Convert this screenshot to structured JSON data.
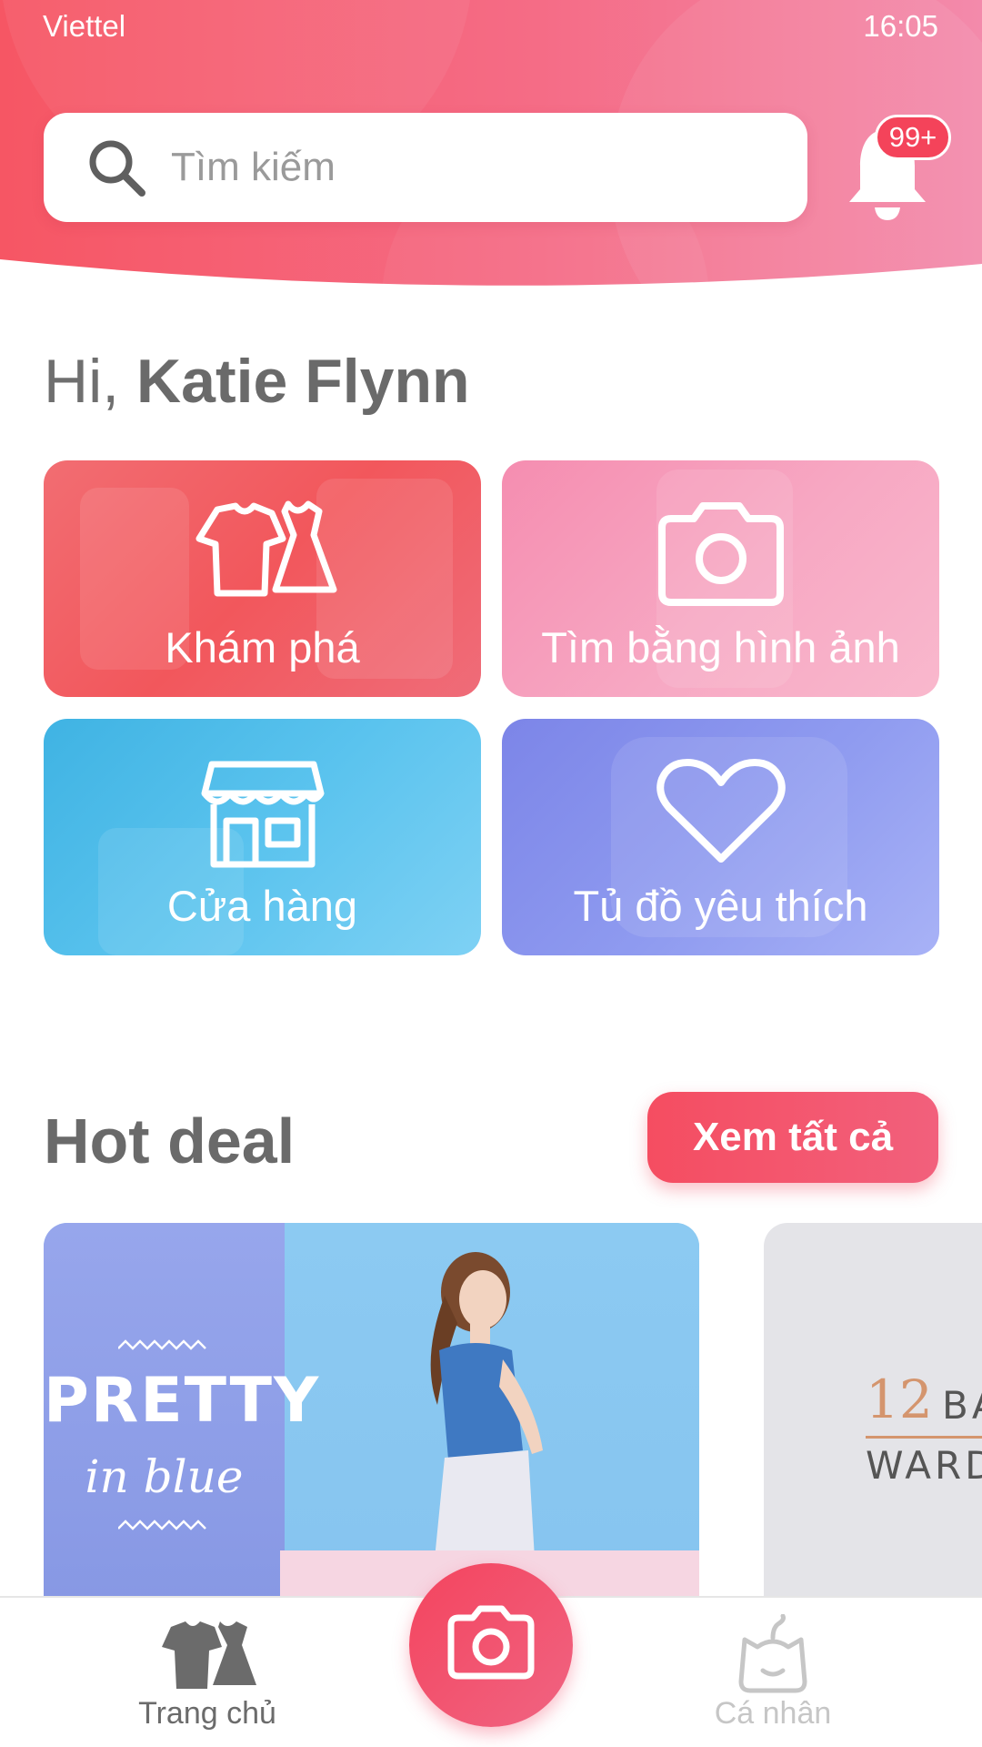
{
  "status_bar": {
    "carrier": "Viettel",
    "time": "16:05"
  },
  "search": {
    "placeholder": "Tìm kiếm"
  },
  "notifications": {
    "badge": "99+"
  },
  "greeting": {
    "hi": "Hi,",
    "name": "Katie Flynn"
  },
  "tiles": [
    {
      "label": "Khám phá",
      "icon": "clothes-icon"
    },
    {
      "label": "Tìm bằng hình ảnh",
      "icon": "camera-icon"
    },
    {
      "label": "Cửa hàng",
      "icon": "store-icon"
    },
    {
      "label": "Tủ đồ yêu thích",
      "icon": "heart-icon"
    }
  ],
  "hot_deal": {
    "title": "Hot deal",
    "see_all": "Xem tất cả",
    "cards": [
      {
        "line1": "PRETTY",
        "line2": "in blue"
      },
      {
        "number": "12",
        "word1": "BA",
        "word2": "WARDR"
      }
    ]
  },
  "bottom_nav": {
    "home": "Trang chủ",
    "profile": "Cá nhân"
  },
  "colors": {
    "accent": "#f4435a",
    "explore": "#f2575c",
    "image_search": "#f7a8c3",
    "store": "#5ac3ee",
    "favorites": "#8f9bf0"
  }
}
